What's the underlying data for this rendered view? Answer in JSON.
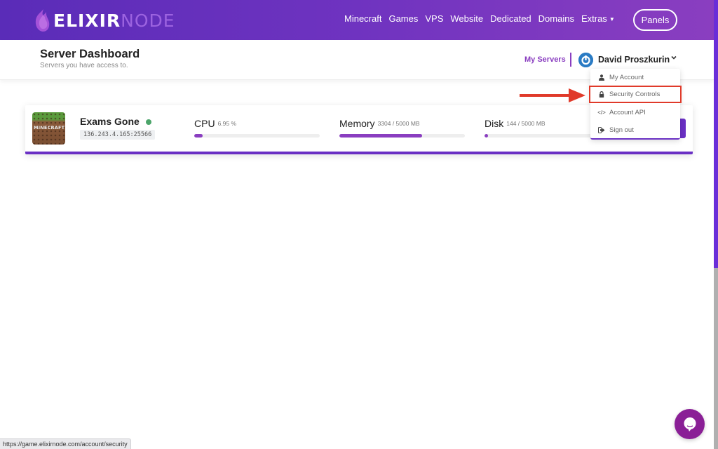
{
  "brand": {
    "name_bold": "ELIXIR",
    "name_light": "NODE"
  },
  "nav": {
    "links": [
      {
        "label": "Minecraft"
      },
      {
        "label": "Games"
      },
      {
        "label": "VPS"
      },
      {
        "label": "Website"
      },
      {
        "label": "Dedicated"
      },
      {
        "label": "Domains"
      },
      {
        "label": "Extras",
        "has_caret": true
      }
    ],
    "extras_caret": "▼",
    "panels_label": "Panels"
  },
  "header": {
    "title": "Server Dashboard",
    "subtitle": "Servers you have access to.",
    "my_servers_label": "My Servers",
    "user_name": "David Proszkurin",
    "user_caret": "⌄"
  },
  "user_menu": {
    "items": [
      {
        "label": "My Account",
        "icon": "user-icon"
      },
      {
        "label": "Security Controls",
        "icon": "lock-icon",
        "highlighted": true
      },
      {
        "label": "Account API",
        "icon": "code-icon",
        "icon_text": "</>"
      },
      {
        "label": "Sign out",
        "icon": "sign-out-icon"
      }
    ]
  },
  "servers": [
    {
      "name": "Exams Gone",
      "status": "online",
      "address": "136.243.4.165:25566",
      "game_icon_text": "MINECRAFT",
      "cpu": {
        "label": "CPU",
        "value": "6.95 %",
        "fraction": 0.0695
      },
      "memory": {
        "label": "Memory",
        "value": "3304 / 5000 MB",
        "fraction": 0.6608
      },
      "disk": {
        "label": "Disk",
        "value": "144 / 5000 MB",
        "fraction": 0.0288
      }
    }
  ],
  "colors": {
    "brand_purple": "#6a30c4",
    "accent_purple": "#8a3ec0",
    "status_online": "#4ca56a",
    "highlight_red": "#e03a2a",
    "chat_purple": "#8a1f96"
  },
  "statusbar": {
    "url": "https://game.elixirnode.com/account/security"
  }
}
